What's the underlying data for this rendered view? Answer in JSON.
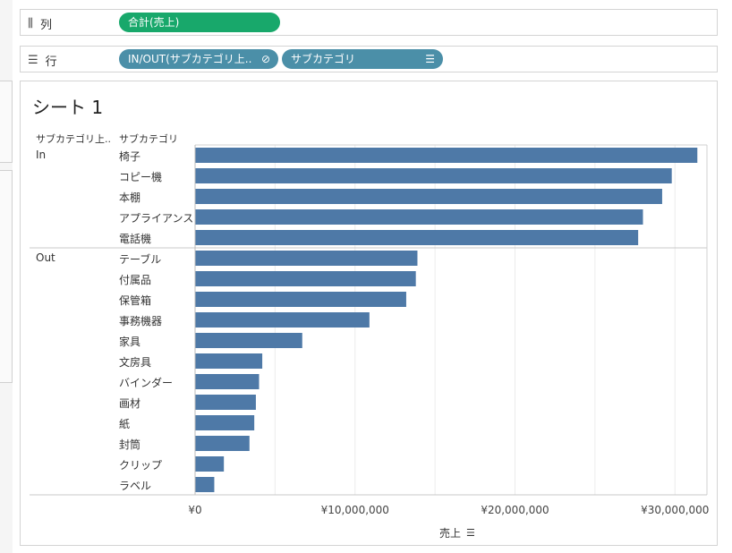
{
  "shelves": {
    "columns": {
      "label": "列",
      "icon": "columns-icon",
      "pill": "合計(売上)"
    },
    "rows": {
      "label": "行",
      "icon": "rows-icon",
      "pills": [
        {
          "label": "IN/OUT(サブカテゴリ上..",
          "icon": "link-icon"
        },
        {
          "label": "サブカテゴリ",
          "icon": "sort-icon"
        }
      ]
    }
  },
  "sheet": {
    "title": "シート 1"
  },
  "headers": {
    "group": "サブカテゴリ上..",
    "category": "サブカテゴリ"
  },
  "chart_data": {
    "type": "bar",
    "orientation": "horizontal",
    "groups": [
      {
        "name": "In",
        "categories": [
          "椅子",
          "コピー機",
          "本棚",
          "アプライアンス",
          "電話機"
        ],
        "values": [
          31400000,
          29800000,
          29200000,
          28000000,
          27700000
        ]
      },
      {
        "name": "Out",
        "categories": [
          "テーブル",
          "付属品",
          "保管箱",
          "事務機器",
          "家具",
          "文房具",
          "バインダー",
          "画材",
          "紙",
          "封筒",
          "クリップ",
          "ラベル"
        ],
        "values": [
          13900000,
          13800000,
          13200000,
          10900000,
          6700000,
          4200000,
          4000000,
          3800000,
          3700000,
          3400000,
          1800000,
          1200000
        ]
      }
    ],
    "xlabel": "売上",
    "xlim": [
      0,
      32000000
    ],
    "xticks": [
      0,
      10000000,
      20000000,
      30000000
    ],
    "xtick_labels": [
      "¥0",
      "¥10,000,000",
      "¥20,000,000",
      "¥30,000,000"
    ],
    "color": "#4e79a7",
    "grid": true
  }
}
